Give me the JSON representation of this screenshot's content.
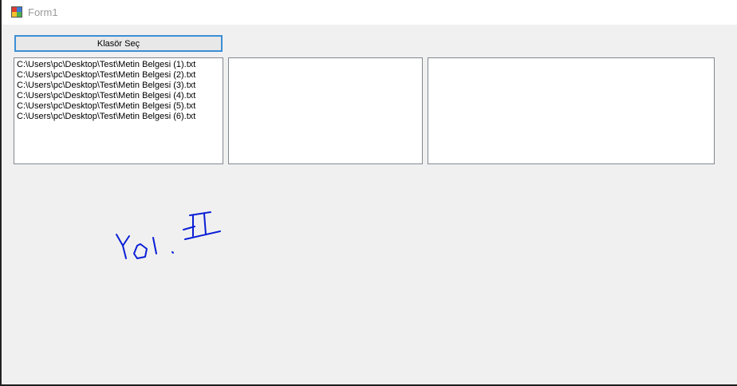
{
  "window": {
    "title": "Form1"
  },
  "toolbar": {
    "select_folder_label": "Klasör Seç"
  },
  "file_list": {
    "items": [
      "C:\\Users\\pc\\Desktop\\Test\\Metin Belgesi (1).txt",
      "C:\\Users\\pc\\Desktop\\Test\\Metin Belgesi (2).txt",
      "C:\\Users\\pc\\Desktop\\Test\\Metin Belgesi (3).txt",
      "C:\\Users\\pc\\Desktop\\Test\\Metin Belgesi (4).txt",
      "C:\\Users\\pc\\Desktop\\Test\\Metin Belgesi (5).txt",
      "C:\\Users\\pc\\Desktop\\Test\\Metin Belgesi (6).txt"
    ]
  },
  "list_two": {
    "items": []
  },
  "list_three": {
    "items": []
  },
  "annotation": {
    "text": "Yol. II",
    "color": "#0000cc"
  },
  "colors": {
    "form_background": "#f0f0f0",
    "button_focus_border": "#3b8ed6",
    "listbox_border": "#828790"
  }
}
